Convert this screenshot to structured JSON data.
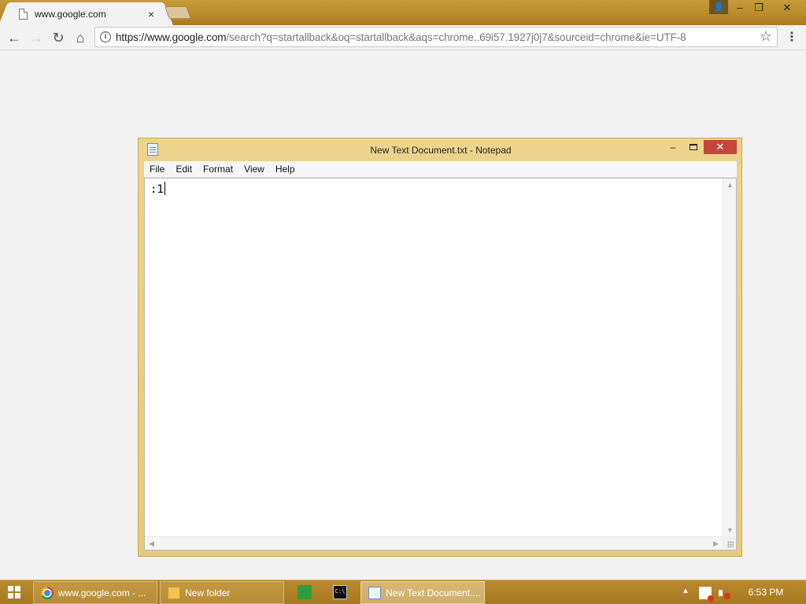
{
  "browser": {
    "tab_title": "www.google.com",
    "tab_close": "×",
    "url_host": "https://www.google.com",
    "url_path": "/search?q=startallback&oq=startallback&aqs=chrome..69i57.1927j0j7&sourceid=chrome&ie=UTF-8",
    "back_glyph": "←",
    "forward_glyph": "→",
    "reload_glyph": "↻",
    "home_glyph": "⌂",
    "star_glyph": "☆",
    "menu_glyph": "⋮",
    "profile_glyph": "👤",
    "minimize_glyph": "–",
    "restore_glyph": "❐",
    "close_glyph": "✕"
  },
  "notepad": {
    "title": "New Text Document.txt - Notepad",
    "menu": [
      "File",
      "Edit",
      "Format",
      "View",
      "Help"
    ],
    "content": ":1",
    "minimize_glyph": "–",
    "close_glyph": "✕",
    "scroll_up": "▲",
    "scroll_down": "▼",
    "scroll_left": "◀",
    "scroll_right": "▶"
  },
  "taskbar": {
    "items": [
      {
        "label": "www.google.com - ...",
        "icon": "chrome-icon"
      },
      {
        "label": "New folder",
        "icon": "folder-icon"
      },
      {
        "label": "New Text Document....",
        "icon": "notepad-icon"
      }
    ],
    "pinned": [
      "store-icon",
      "command-prompt-icon"
    ],
    "cmd_label": "C:\\",
    "tray_arrow": "▲",
    "clock": "6:53 PM"
  },
  "colors": {
    "taskbar": "#b8892d",
    "notepad_frame": "#edd38c",
    "close_red": "#c7463b"
  }
}
